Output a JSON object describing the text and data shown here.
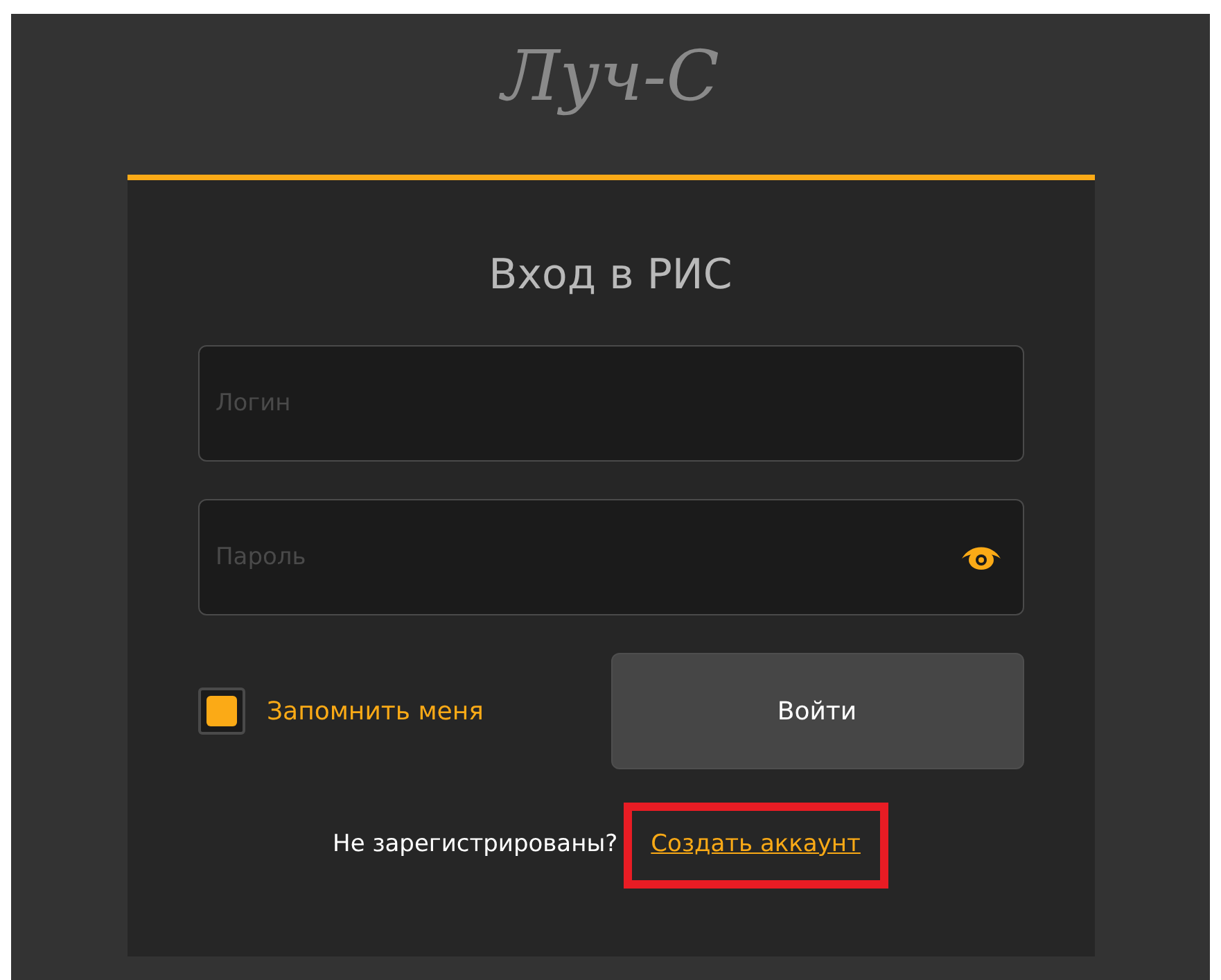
{
  "logo": "Луч-С",
  "title": "Вход в РИС",
  "fields": [
    {
      "kind": "text",
      "placeholder": "Логин"
    },
    {
      "kind": "password",
      "placeholder": "Пароль"
    }
  ],
  "remember": {
    "label": "Запомнить меня",
    "checked": true
  },
  "submit": "Войти",
  "signup": {
    "prompt": "Не зарегистрированы?",
    "link": "Создать аккаунт",
    "highlighted": true
  }
}
